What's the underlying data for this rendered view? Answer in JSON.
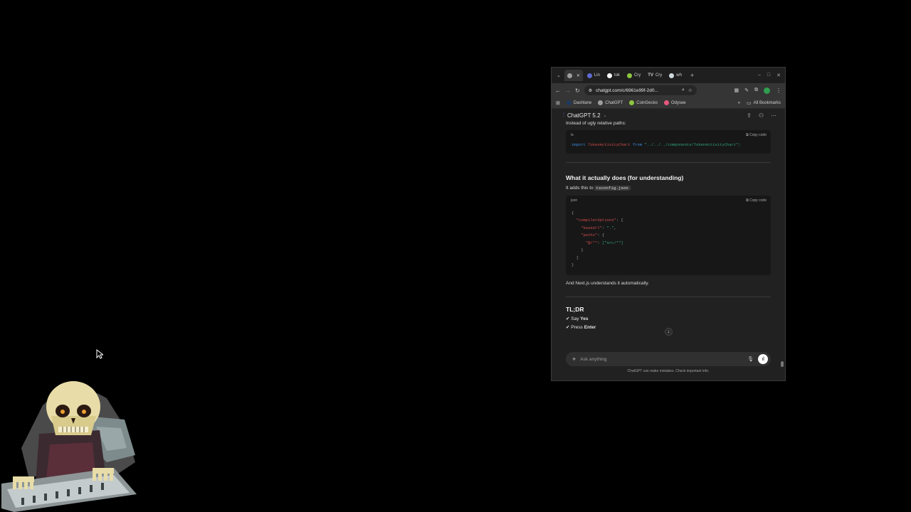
{
  "browser": {
    "tabs": [
      {
        "label": "",
        "icon": "chatgpt-icon",
        "color": "#9e9e9e",
        "active": true
      },
      {
        "label": "Lin",
        "icon": "linear-icon",
        "color": "#5e6ad2"
      },
      {
        "label": "tok",
        "icon": "github-icon",
        "color": "#ffffff"
      },
      {
        "label": "Cry",
        "icon": "coingecko-icon",
        "color": "#8dc63f"
      },
      {
        "label": "Cry",
        "icon": "tv-icon",
        "color": "#ffffff"
      },
      {
        "label": "wh",
        "icon": "globe-icon",
        "color": "#cfd8dc"
      }
    ],
    "url": "chatgpt.com/c/6961e99f-2d0...",
    "bookmarks": [
      {
        "label": "Dashlane",
        "color": "#1e3a5f"
      },
      {
        "label": "ChatGPT",
        "color": "#9e9e9e"
      },
      {
        "label": "CoinGecko",
        "color": "#8dc63f"
      },
      {
        "label": "Odysee",
        "color": "#e8577d"
      }
    ],
    "all_bookmarks": "All Bookmarks"
  },
  "chat": {
    "model": "ChatGPT 5.2",
    "intro_text": "Instead of ugly relative paths:",
    "code1": {
      "lang": "ts",
      "copy_label": "Copy code",
      "import_kw": "import",
      "ident": "TokenActivityChart",
      "from_kw": "from",
      "path": "\"../../../components/TokenActivityChart\";"
    },
    "heading1": "What it actually does (for understanding)",
    "adds_text_prefix": "It adds this to",
    "adds_file": "tsconfig.json",
    "adds_text_suffix": ":",
    "code2": {
      "lang": "json",
      "copy_label": "Copy code",
      "open_brace": "{",
      "compiler_key": "\"compilerOptions\"",
      "baseurl_key": "\"baseUrl\"",
      "baseurl_val": "\".\"",
      "paths_key": "\"paths\"",
      "alias_key": "\"@/*\"",
      "alias_val": "[\"src/*\"]",
      "close_inner": "}",
      "close_mid": "}",
      "close_brace": "}"
    },
    "after_text": "And Next.js understands it automatically.",
    "tldr_heading": "TL;DR",
    "tldr_items": [
      {
        "prefix": "✔ Say ",
        "bold": "Yes"
      },
      {
        "prefix": "✔ Press ",
        "bold": "Enter"
      }
    ],
    "placeholder": "Ask anything",
    "footer": "ChatGPT can make mistakes. Check important info."
  }
}
